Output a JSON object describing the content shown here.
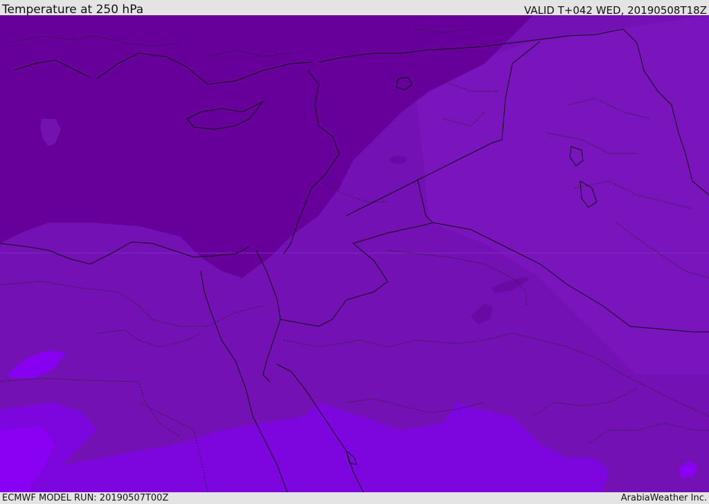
{
  "header": {
    "title": "Temperature at 250 hPa",
    "valid_time": "VALID T+042 WED, 20190508T18Z"
  },
  "footer": {
    "model_run": "ECMWF MODEL RUN: 20190507T00Z",
    "credit": "ArabiaWeather Inc."
  },
  "map": {
    "field": "temperature",
    "level": "250 hPa",
    "colors": {
      "coldest": "#6a009a",
      "cold": "#7412b0",
      "mid": "#7b12bf",
      "warm": "#7d06de",
      "warmest": "#8800f0",
      "border": "#111111"
    }
  }
}
